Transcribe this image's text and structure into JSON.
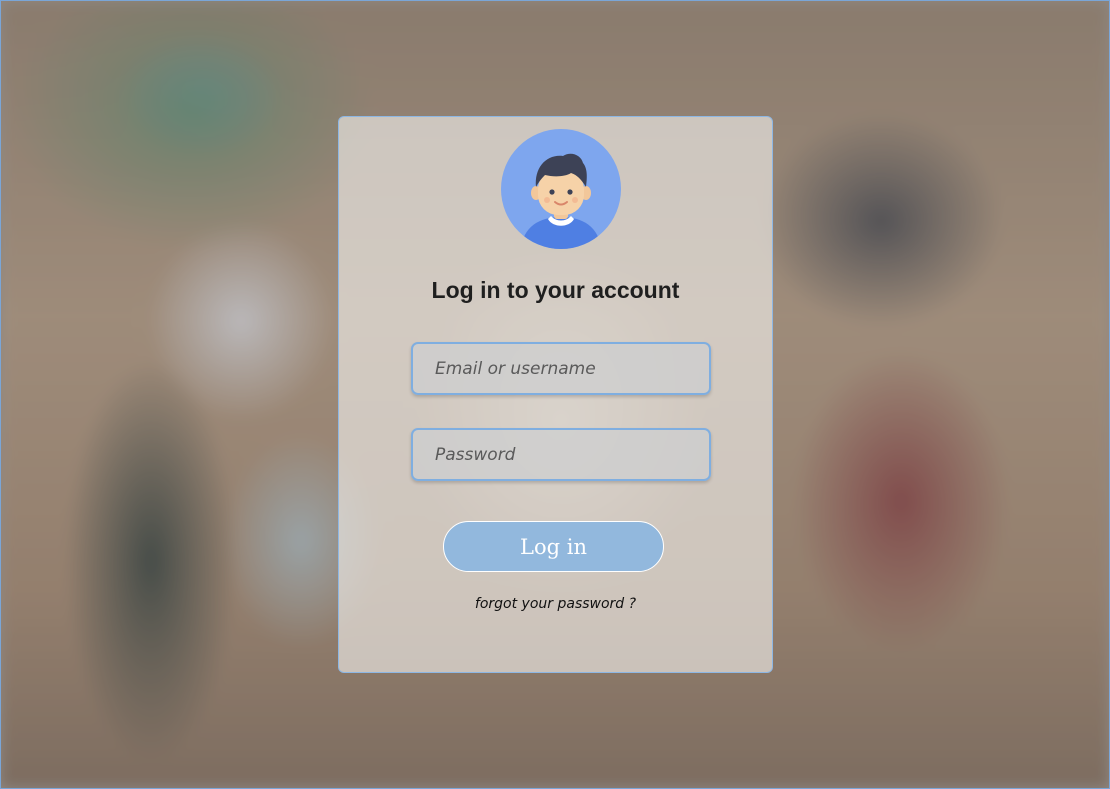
{
  "login": {
    "title": "Log in to your account",
    "email_placeholder": "Email or username",
    "password_placeholder": "Password",
    "login_button_label": "Log in",
    "forgot_link": "forgot your password ?"
  },
  "icons": {
    "avatar": "user-avatar-icon"
  },
  "colors": {
    "accent": "#92b8dd",
    "field_border": "#7faee0",
    "avatar_bg": "#7ea6ee"
  }
}
